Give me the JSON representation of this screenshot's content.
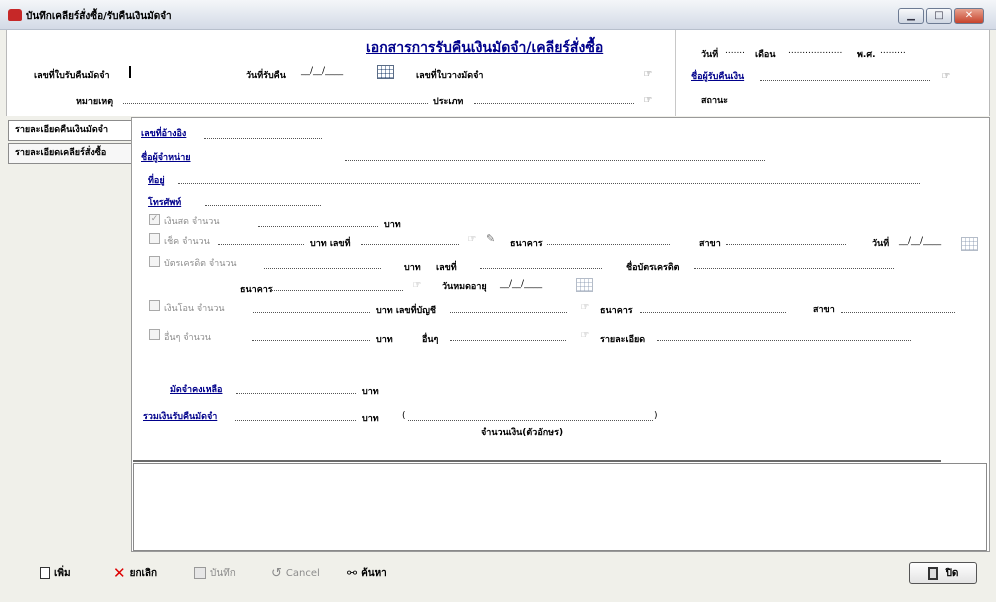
{
  "window": {
    "title": "บันทึกเคลียร์สั่งซื้อ/รับคืนเงินมัดจำ",
    "minimize": "▁",
    "maximize": "□",
    "close": "✕"
  },
  "header": {
    "doc_title": "เอกสารการรับคืนเงินมัดจำ/เคลียร์สั่งซื้อ",
    "refund_no_label": "เลขที่ใบรับคืนมัดจำ",
    "refund_date_label": "วันที่รับคืน",
    "refund_date_value": "__/__/____",
    "deposit_no_label": "เลขที่ใบวางมัดจำ",
    "remark_label": "หมายเหตุ",
    "type_label": "ประเภท",
    "day_label": "วันที่",
    "day_value": ".......",
    "month_label": "เดือน",
    "month_value": "...................",
    "year_label": "พ.ศ.",
    "year_value": ".........",
    "receiver_label": "ชื่อผู้รับคืนเงิน",
    "status_label": "สถานะ"
  },
  "tabs": [
    {
      "label": "รายละเอียดคืนเงินมัดจำ",
      "active": true
    },
    {
      "label": "รายละเอียดเคลียร์สั่งซื้อ",
      "active": false
    }
  ],
  "form": {
    "ref_no_label": "เลขที่อ้างอิง",
    "vendor_label": "ชื่อผู้จำหน่าย",
    "address_label": "ที่อยู่",
    "phone_label": "โทรศัพท์",
    "cash_label": "เงินสด จำนวน",
    "baht": "บาท",
    "cheque_label": "เช็ค จำนวน",
    "baht_no": "บาท  เลขที่",
    "bank_label": "ธนาคาร",
    "branch_label": "สาขา",
    "date_label": "วันที่",
    "date_value": "__/__/____",
    "credit_label": "บัตรเครดิต  จำนวน",
    "no_label": "เลขที่",
    "card_name_label": "ชื่อบัตรเครดิต",
    "card_bank_label": "ธนาคาร",
    "expire_label": "วันหมดอายุ",
    "expire_value": "__/__/____",
    "transfer_label": "เงินโอน จำนวน",
    "baht_account": "บาท เลขที่บัญชี",
    "other_label": "อื่นๆ จำนวน",
    "others_label": "อื่นๆ",
    "detail_label": "รายละเอียด",
    "deposit_left_label": "มัดจำคงเหลือ",
    "total_label": "รวมเงินรับคืนมัดจำ",
    "amount_text_open": "(",
    "amount_text_close": ")",
    "amount_text_label": "จำนวนเงิน(ตัวอักษร)"
  },
  "toolbar": {
    "add": "เพิ่ม",
    "cancel_doc": "ยกเลิก",
    "save": "บันทึก",
    "cancel": "Cancel",
    "search": "ค้นหา",
    "close": "ปิด"
  },
  "colors": {
    "link": "#00008b",
    "title_red": "#c62828"
  }
}
